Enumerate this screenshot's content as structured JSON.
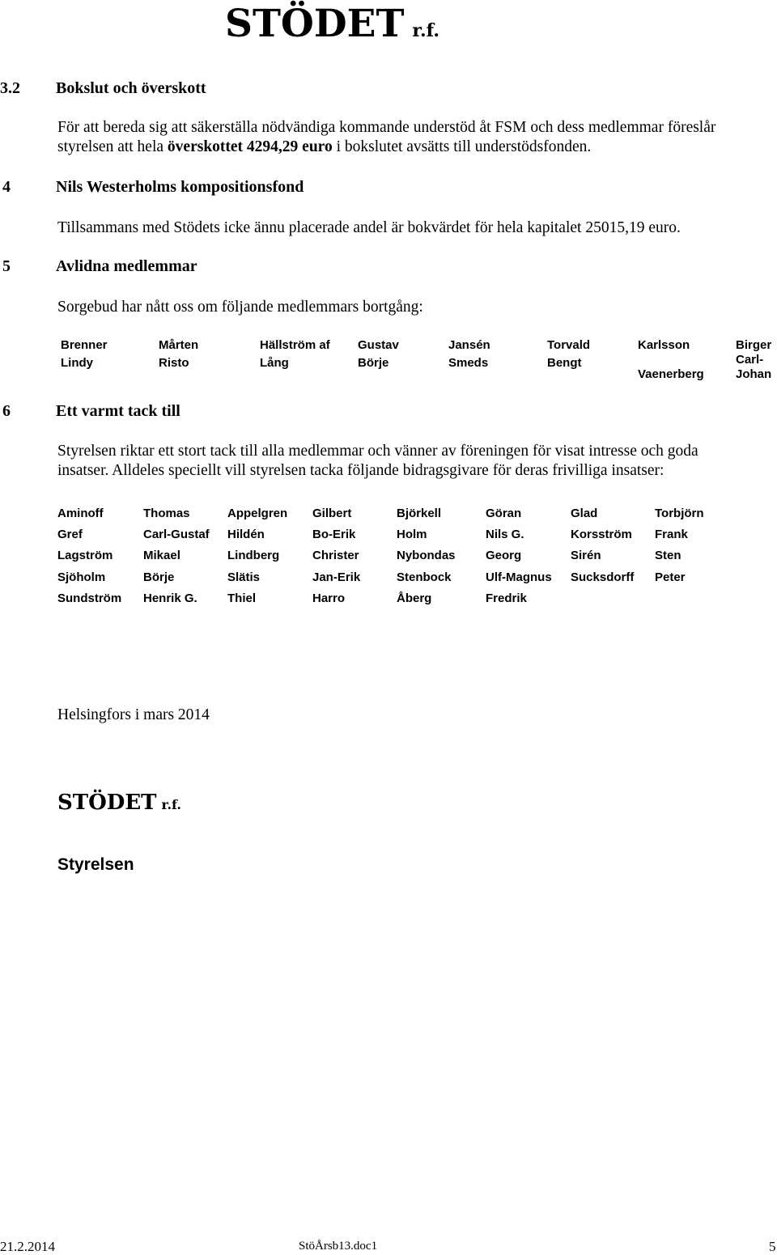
{
  "header": {
    "logo_main": "STÖDET",
    "logo_suffix": "r.f."
  },
  "sections": {
    "s32": {
      "number": "3.2",
      "title": "Bokslut och överskott",
      "para_line1": "För att bereda sig att säkerställa nödvändiga kommande understöd åt FSM och dess medlemmar föreslår",
      "para_line2_pre": "styrelsen att hela ",
      "para_line2_bold": "överskottet 4294,29 euro",
      "para_line2_post": " i bokslutet avsätts till understödsfonden."
    },
    "s4": {
      "number": "4",
      "title": "Nils Westerholms kompositionsfond",
      "para": "Tillsammans med Stödets icke ännu placerade andel är bokvärdet för hela kapitalet 25015,19 euro."
    },
    "s5": {
      "number": "5",
      "title": "Avlidna medlemmar",
      "para": "Sorgebud har nått oss om följande medlemmars bortgång:",
      "deceased": [
        {
          "surname": "Brenner",
          "given": "Lindy"
        },
        {
          "surname": "Mårten",
          "given": "Risto"
        },
        {
          "surname": "Hällström af",
          "given": "Lång"
        },
        {
          "surname": "Gustav",
          "given": "Börje"
        },
        {
          "surname": "Jansén",
          "given": "Smeds"
        },
        {
          "surname": "Torvald",
          "given": "Bengt"
        },
        {
          "surname": "Karlsson",
          "given": "Vaenerberg"
        },
        {
          "surname": "Birger",
          "given": "Carl-",
          "given2": "Johan"
        }
      ]
    },
    "s6": {
      "number": "6",
      "title": "Ett varmt tack till",
      "para_line1": "Styrelsen riktar ett stort tack till alla medlemmar och vänner av föreningen för visat intresse och goda",
      "para_line2": "insatser. Alldeles speciellt vill styrelsen tacka följande bidragsgivare för deras frivilliga insatser:",
      "donors": [
        [
          "Aminoff",
          "Thomas",
          "Appelgren",
          "Gilbert",
          "Björkell",
          "Göran",
          "Glad",
          "Torbjörn"
        ],
        [
          "Gref",
          "Carl-Gustaf",
          "Hildén",
          "Bo-Erik",
          "Holm",
          "Nils G.",
          "Korsström",
          "Frank"
        ],
        [
          "Lagström",
          "Mikael",
          "Lindberg",
          "Christer",
          "Nybondas",
          "Georg",
          "Sirén",
          "Sten"
        ],
        [
          "Sjöholm",
          "Börje",
          "Slätis",
          "Jan-Erik",
          "Stenbock",
          "Ulf-Magnus",
          "Sucksdorff",
          "Peter"
        ],
        [
          "Sundström",
          "Henrik G.",
          "Thiel",
          "Harro",
          "Åberg",
          "Fredrik",
          "",
          ""
        ]
      ]
    }
  },
  "signature": {
    "place_date": "Helsingfors i mars 2014",
    "org_main": "STÖDET",
    "org_suffix": "r.f.",
    "board": "Styrelsen"
  },
  "footer": {
    "date": "21.2.2014",
    "filename": "StöÅrsb13.doc1",
    "page": "5"
  }
}
